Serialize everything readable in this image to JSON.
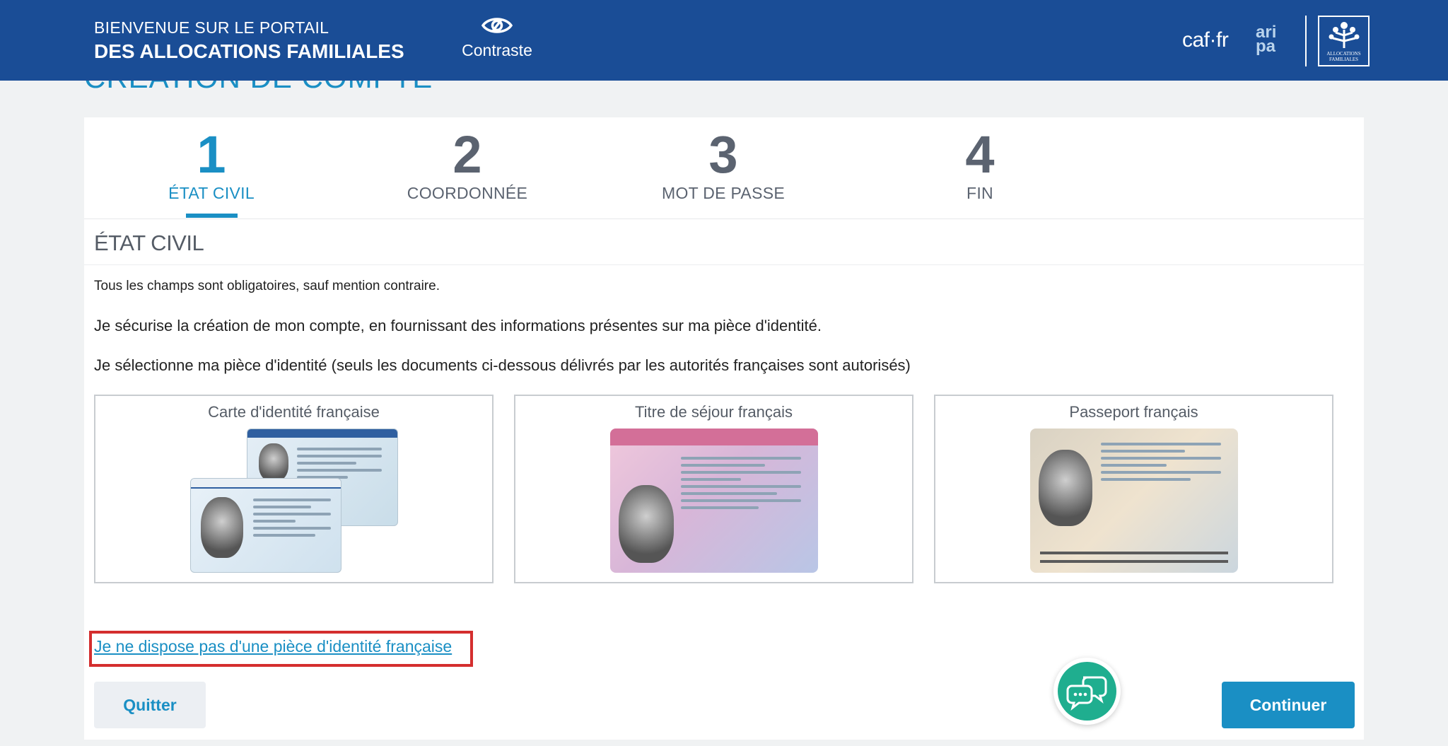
{
  "header": {
    "welcome_line1": "BIENVENUE SUR LE PORTAIL",
    "welcome_line2": "DES ALLOCATIONS FAMILIALES",
    "contrast_label": "Contraste",
    "logo_caf": "caf·fr",
    "logo_aripa_top": "ari",
    "logo_aripa_bottom": "pa",
    "logo_af_text": "ALLOCATIONS FAMILIALES",
    "brand_color": "#1a4d96"
  },
  "page_title": "CRÉATION DE COMPTE",
  "steps": [
    {
      "number": "1",
      "label": "ÉTAT CIVIL",
      "active": true
    },
    {
      "number": "2",
      "label": "COORDONNÉE",
      "active": false
    },
    {
      "number": "3",
      "label": "MOT DE PASSE",
      "active": false
    },
    {
      "number": "4",
      "label": "FIN",
      "active": false
    }
  ],
  "section_title": "ÉTAT CIVIL",
  "required_note": "Tous les champs sont obligatoires, sauf mention contraire.",
  "intro": "Je sécurise la création de mon compte, en fournissant des informations présentes sur ma pièce d'identité.",
  "select_instruction": "Je sélectionne ma pièce d'identité (seuls les documents ci-dessous délivrés par les autorités françaises sont autorisés)",
  "documents": [
    {
      "title": "Carte d'identité française"
    },
    {
      "title": "Titre de séjour français"
    },
    {
      "title": "Passeport français"
    }
  ],
  "no_id_link": "Je ne dispose pas d'une pièce d'identité française",
  "buttons": {
    "quit": "Quitter",
    "continue": "Continuer"
  },
  "accent_color": "#1a8fc4",
  "highlight_color": "#d42e2e"
}
